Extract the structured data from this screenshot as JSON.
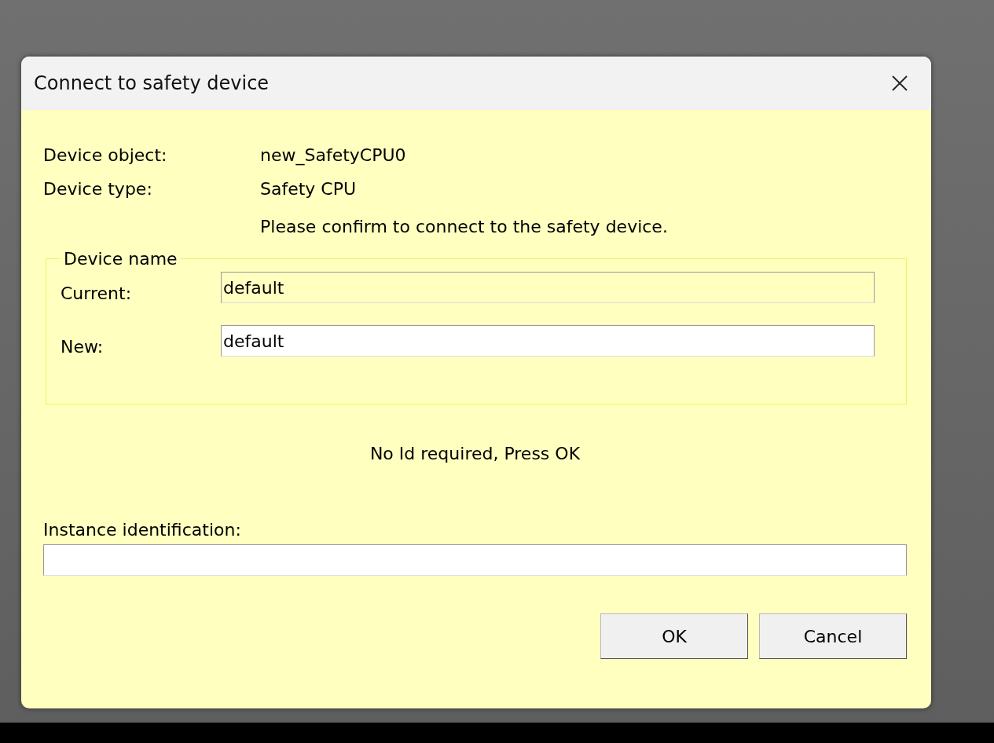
{
  "window": {
    "title": "Connect to safety device"
  },
  "info": [
    {
      "label": "Device object:",
      "value": "new_SafetyCPU0"
    },
    {
      "label": "Device type:",
      "value": "Safety CPU"
    }
  ],
  "prompt": "Please confirm to connect to the safety device.",
  "device_name": {
    "legend": "Device name",
    "fields": [
      {
        "label": "Current:",
        "value": "default",
        "readonly": true
      },
      {
        "label": "New:",
        "value": "default",
        "readonly": false
      }
    ]
  },
  "status": "No Id required, Press OK",
  "instance": {
    "label": "Instance identification:"
  },
  "buttons": [
    "OK",
    "Cancel"
  ]
}
